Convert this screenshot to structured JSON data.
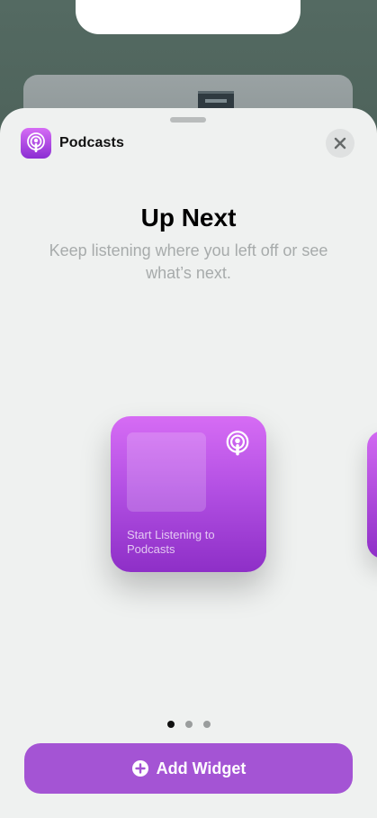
{
  "app": {
    "name": "Podcasts",
    "icon": "podcasts-icon",
    "accent_color": "#a454d4"
  },
  "widget_gallery": {
    "title": "Up Next",
    "subtitle": "Keep listening where you left off or see what’s next.",
    "widget": {
      "caption": "Start Listening to Podcasts"
    },
    "pages": {
      "count": 3,
      "current": 1
    }
  },
  "actions": {
    "close_icon": "close-icon",
    "add_widget_label": "Add Widget",
    "add_widget_icon": "plus-circle-icon"
  }
}
